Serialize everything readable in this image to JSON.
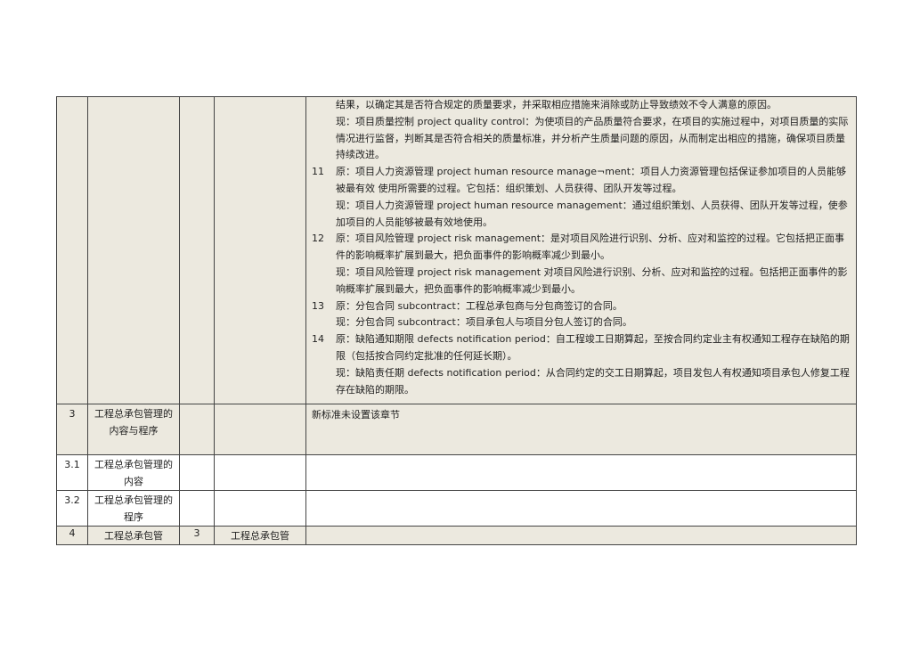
{
  "table": {
    "row_main": {
      "intro_paragraphs": [
        "结果，以确定其是否符合规定的质量要求，并采取相应措施来消除或防止导致绩效不令人满意的原因。",
        "现：项目质量控制  project quality control：为使项目的产品质量符合要求，在项目的实施过程中，对项目质量的实际情况进行监督，判断其是否符合相关的质量标准，并分析产生质量问题的原因，从而制定出相应的措施，确保项目质量持续改进。"
      ],
      "items": [
        {
          "number": "11",
          "original": "原：项目人力资源管理  project human resource manage¬ment：项目人力资源管理包括保证参加项目的人员能够被最有效  使用所需要的过程。它包括：组织策划、人员获得、团队开发等过程。",
          "current": "现：项目人力资源管理  project human resource management：通过组织策划、人员获得、团队开发等过程，使参加项目的人员能够被最有效地使用。"
        },
        {
          "number": "12",
          "original": "原：项目风险管理  project risk management：是对项目风险进行识别、分析、应对和监控的过程。它包括把正面事件的影响概率扩展到最大，把负面事件的影响概率减少到最小。",
          "current": "现：项目风险管理  project  risk  management 对项目风险进行识别、分析、应对和监控的过程。包括把正面事件的影响概率扩展到最大，把负面事件的影响概率减少到最小。"
        },
        {
          "number": "13",
          "original": "原：分包合同  subcontract：工程总承包商与分包商签订的合同。",
          "current": "现：分包合同  subcontract：项目承包人与项目分包人签订的合同。"
        },
        {
          "number": "14",
          "original": "原：缺陷通知期限  defects notification period：自工程竣工日期算起，至按合同约定业主有权通知工程存在缺陷的期限（包括按合同约定批准的任何延长期）。",
          "current": "现：缺陷责任期  defects notification period：从合同约定的交工日期算起，项目发包人有权通知项目承包人修复工程存在缺陷的期限。"
        }
      ]
    },
    "row_3": {
      "number": "3",
      "name": "工程总承包管理的内容与程序",
      "content": "新标准未设置该章节"
    },
    "row_3_1": {
      "number": "3.1",
      "name": "工程总承包管理的内容"
    },
    "row_3_2": {
      "number": "3.2",
      "name": "工程总承包管理的程序"
    },
    "row_4": {
      "number": "4",
      "name": "工程总承包管",
      "new_number": "3",
      "new_name": "工程总承包管"
    }
  }
}
